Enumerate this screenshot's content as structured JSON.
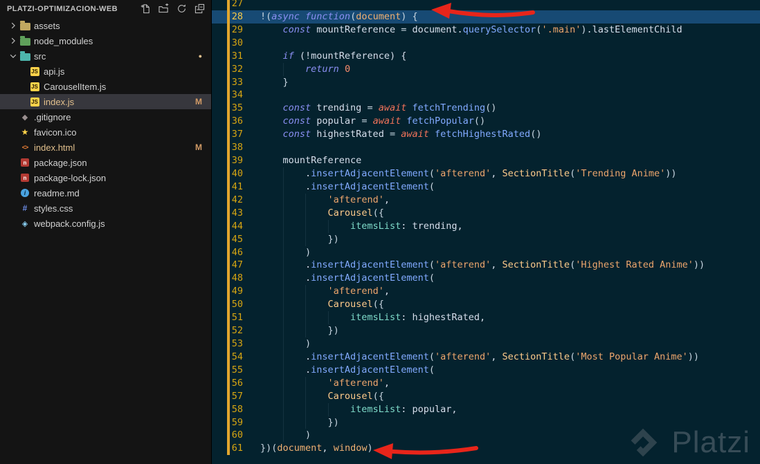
{
  "sidebar": {
    "title": "PLATZI-OPTIMIZACION-WEB",
    "actions": [
      {
        "name": "new-file",
        "glyph": "new-file"
      },
      {
        "name": "new-folder",
        "glyph": "new-folder"
      },
      {
        "name": "refresh-explorer",
        "glyph": "refresh"
      },
      {
        "name": "collapse-folders",
        "glyph": "collapse-all"
      }
    ],
    "tree": [
      {
        "label": "assets",
        "type": "folder",
        "depth": 0,
        "chevron": "collapsed",
        "icon": "folder-assets"
      },
      {
        "label": "node_modules",
        "type": "folder",
        "depth": 0,
        "chevron": "collapsed",
        "icon": "folder-node"
      },
      {
        "label": "src",
        "type": "folder",
        "depth": 0,
        "chevron": "expanded",
        "icon": "folder-src",
        "badge": "●"
      },
      {
        "label": "api.js",
        "type": "file",
        "depth": 1,
        "icon": "js"
      },
      {
        "label": "CarouselItem.js",
        "type": "file",
        "depth": 1,
        "icon": "js"
      },
      {
        "label": "index.js",
        "type": "file",
        "depth": 1,
        "icon": "js",
        "badge": "M",
        "selected": true,
        "modified": true
      },
      {
        "label": ".gitignore",
        "type": "file",
        "depth": 0,
        "icon": "git"
      },
      {
        "label": "favicon.ico",
        "type": "file",
        "depth": 0,
        "icon": "star"
      },
      {
        "label": "index.html",
        "type": "file",
        "depth": 0,
        "icon": "html",
        "badge": "M",
        "modified": true
      },
      {
        "label": "package.json",
        "type": "file",
        "depth": 0,
        "icon": "npm"
      },
      {
        "label": "package-lock.json",
        "type": "file",
        "depth": 0,
        "icon": "npm"
      },
      {
        "label": "readme.md",
        "type": "file",
        "depth": 0,
        "icon": "info"
      },
      {
        "label": "styles.css",
        "type": "file",
        "depth": 0,
        "icon": "css"
      },
      {
        "label": "webpack.config.js",
        "type": "file",
        "depth": 0,
        "icon": "webpack"
      }
    ]
  },
  "editor": {
    "active_line": 28,
    "lines": [
      {
        "n": 27,
        "mod": true,
        "tokens": []
      },
      {
        "n": 28,
        "mod": true,
        "tokens": [
          [
            "!(",
            "pun"
          ],
          [
            "async function",
            "kw"
          ],
          [
            "(",
            "pun"
          ],
          [
            "document",
            "par"
          ],
          [
            ") {",
            "pun"
          ]
        ]
      },
      {
        "n": 29,
        "mod": true,
        "tokens": [
          [
            "    ",
            "pln"
          ],
          [
            "const",
            "kw"
          ],
          [
            " mountReference ",
            "pln"
          ],
          [
            "=",
            "op"
          ],
          [
            " document.",
            "pln"
          ],
          [
            "querySelector",
            "fn"
          ],
          [
            "(",
            "pun"
          ],
          [
            "'.main'",
            "str"
          ],
          [
            ")",
            "pun"
          ],
          [
            ".lastElementChild",
            "pln"
          ]
        ]
      },
      {
        "n": 30,
        "mod": true,
        "tokens": []
      },
      {
        "n": 31,
        "mod": true,
        "tokens": [
          [
            "    ",
            "pln"
          ],
          [
            "if",
            "kw"
          ],
          [
            " (!mountReference) {",
            "pln"
          ]
        ]
      },
      {
        "n": 32,
        "mod": true,
        "tokens": [
          [
            "        ",
            "pln"
          ],
          [
            "return",
            "kw"
          ],
          [
            " ",
            "pln"
          ],
          [
            "0",
            "num"
          ]
        ]
      },
      {
        "n": 33,
        "mod": true,
        "tokens": [
          [
            "    }",
            "pun"
          ]
        ]
      },
      {
        "n": 34,
        "mod": true,
        "tokens": []
      },
      {
        "n": 35,
        "mod": true,
        "tokens": [
          [
            "    ",
            "pln"
          ],
          [
            "const",
            "kw"
          ],
          [
            " trending ",
            "pln"
          ],
          [
            "=",
            "op"
          ],
          [
            " ",
            "pln"
          ],
          [
            "await",
            "awt"
          ],
          [
            " ",
            "pln"
          ],
          [
            "fetchTrending",
            "fn"
          ],
          [
            "()",
            "pun"
          ]
        ]
      },
      {
        "n": 36,
        "mod": true,
        "tokens": [
          [
            "    ",
            "pln"
          ],
          [
            "const",
            "kw"
          ],
          [
            " popular ",
            "pln"
          ],
          [
            "=",
            "op"
          ],
          [
            " ",
            "pln"
          ],
          [
            "await",
            "awt"
          ],
          [
            " ",
            "pln"
          ],
          [
            "fetchPopular",
            "fn"
          ],
          [
            "()",
            "pun"
          ]
        ]
      },
      {
        "n": 37,
        "mod": true,
        "tokens": [
          [
            "    ",
            "pln"
          ],
          [
            "const",
            "kw"
          ],
          [
            " highestRated ",
            "pln"
          ],
          [
            "=",
            "op"
          ],
          [
            " ",
            "pln"
          ],
          [
            "await",
            "awt"
          ],
          [
            " ",
            "pln"
          ],
          [
            "fetchHighestRated",
            "fn"
          ],
          [
            "()",
            "pun"
          ]
        ]
      },
      {
        "n": 38,
        "mod": true,
        "tokens": []
      },
      {
        "n": 39,
        "mod": true,
        "tokens": [
          [
            "    mountReference",
            "pln"
          ]
        ]
      },
      {
        "n": 40,
        "mod": true,
        "tokens": [
          [
            "        .",
            "pln"
          ],
          [
            "insertAdjacentElement",
            "fn"
          ],
          [
            "(",
            "pun"
          ],
          [
            "'afterend'",
            "str"
          ],
          [
            ", ",
            "pln"
          ],
          [
            "SectionTitle",
            "cls"
          ],
          [
            "(",
            "pun"
          ],
          [
            "'Trending Anime'",
            "str"
          ],
          [
            "))",
            "pun"
          ]
        ]
      },
      {
        "n": 41,
        "mod": true,
        "tokens": [
          [
            "        .",
            "pln"
          ],
          [
            "insertAdjacentElement",
            "fn"
          ],
          [
            "(",
            "pun"
          ]
        ]
      },
      {
        "n": 42,
        "mod": true,
        "tokens": [
          [
            "            ",
            "pln"
          ],
          [
            "'afterend'",
            "str"
          ],
          [
            ",",
            "pln"
          ]
        ]
      },
      {
        "n": 43,
        "mod": true,
        "tokens": [
          [
            "            ",
            "pln"
          ],
          [
            "Carousel",
            "cls"
          ],
          [
            "({",
            "pun"
          ]
        ]
      },
      {
        "n": 44,
        "mod": true,
        "tokens": [
          [
            "                ",
            "pln"
          ],
          [
            "itemsList",
            "prop"
          ],
          [
            ": trending,",
            "pln"
          ]
        ]
      },
      {
        "n": 45,
        "mod": true,
        "tokens": [
          [
            "            })",
            "pun"
          ]
        ]
      },
      {
        "n": 46,
        "mod": true,
        "tokens": [
          [
            "        )",
            "pun"
          ]
        ]
      },
      {
        "n": 47,
        "mod": true,
        "tokens": [
          [
            "        .",
            "pln"
          ],
          [
            "insertAdjacentElement",
            "fn"
          ],
          [
            "(",
            "pun"
          ],
          [
            "'afterend'",
            "str"
          ],
          [
            ", ",
            "pln"
          ],
          [
            "SectionTitle",
            "cls"
          ],
          [
            "(",
            "pun"
          ],
          [
            "'Highest Rated Anime'",
            "str"
          ],
          [
            "))",
            "pun"
          ]
        ]
      },
      {
        "n": 48,
        "mod": true,
        "tokens": [
          [
            "        .",
            "pln"
          ],
          [
            "insertAdjacentElement",
            "fn"
          ],
          [
            "(",
            "pun"
          ]
        ]
      },
      {
        "n": 49,
        "mod": true,
        "tokens": [
          [
            "            ",
            "pln"
          ],
          [
            "'afterend'",
            "str"
          ],
          [
            ",",
            "pln"
          ]
        ]
      },
      {
        "n": 50,
        "mod": true,
        "tokens": [
          [
            "            ",
            "pln"
          ],
          [
            "Carousel",
            "cls"
          ],
          [
            "({",
            "pun"
          ]
        ]
      },
      {
        "n": 51,
        "mod": true,
        "tokens": [
          [
            "                ",
            "pln"
          ],
          [
            "itemsList",
            "prop"
          ],
          [
            ": highestRated,",
            "pln"
          ]
        ]
      },
      {
        "n": 52,
        "mod": true,
        "tokens": [
          [
            "            })",
            "pun"
          ]
        ]
      },
      {
        "n": 53,
        "mod": true,
        "tokens": [
          [
            "        )",
            "pun"
          ]
        ]
      },
      {
        "n": 54,
        "mod": true,
        "tokens": [
          [
            "        .",
            "pln"
          ],
          [
            "insertAdjacentElement",
            "fn"
          ],
          [
            "(",
            "pun"
          ],
          [
            "'afterend'",
            "str"
          ],
          [
            ", ",
            "pln"
          ],
          [
            "SectionTitle",
            "cls"
          ],
          [
            "(",
            "pun"
          ],
          [
            "'Most Popular Anime'",
            "str"
          ],
          [
            "))",
            "pun"
          ]
        ]
      },
      {
        "n": 55,
        "mod": true,
        "tokens": [
          [
            "        .",
            "pln"
          ],
          [
            "insertAdjacentElement",
            "fn"
          ],
          [
            "(",
            "pun"
          ]
        ]
      },
      {
        "n": 56,
        "mod": true,
        "tokens": [
          [
            "            ",
            "pln"
          ],
          [
            "'afterend'",
            "str"
          ],
          [
            ",",
            "pln"
          ]
        ]
      },
      {
        "n": 57,
        "mod": true,
        "tokens": [
          [
            "            ",
            "pln"
          ],
          [
            "Carousel",
            "cls"
          ],
          [
            "({",
            "pun"
          ]
        ]
      },
      {
        "n": 58,
        "mod": true,
        "tokens": [
          [
            "                ",
            "pln"
          ],
          [
            "itemsList",
            "prop"
          ],
          [
            ": popular,",
            "pln"
          ]
        ]
      },
      {
        "n": 59,
        "mod": true,
        "tokens": [
          [
            "            })",
            "pun"
          ]
        ]
      },
      {
        "n": 60,
        "mod": true,
        "tokens": [
          [
            "        )",
            "pun"
          ]
        ]
      },
      {
        "n": 61,
        "mod": true,
        "tokens": [
          [
            "})(",
            "pun"
          ],
          [
            "document",
            "par"
          ],
          [
            ", ",
            "pln"
          ],
          [
            "window",
            "par"
          ],
          [
            ")",
            "pun"
          ]
        ]
      }
    ]
  },
  "watermark": {
    "text": "Platzi"
  },
  "annotations": [
    {
      "type": "arrow",
      "color": "#e8251a",
      "points_to": "line-28"
    },
    {
      "type": "arrow",
      "color": "#e8251a",
      "points_to": "line-61"
    }
  ],
  "colors": {
    "editor_background": "#04222e",
    "sidebar_background": "#141414",
    "active_line": "#174a74",
    "line_number": "#d7a512",
    "git_gutter": "#e2a62e",
    "modified_badge": "#d19a66",
    "selected_row": "#37373d",
    "arrow_red": "#e8251a",
    "keyword": "#8a8ff2",
    "string": "#eda56c",
    "function": "#82aaff",
    "class": "#ffcb8b",
    "property": "#7fdbca",
    "watermark": "#5a6973"
  }
}
